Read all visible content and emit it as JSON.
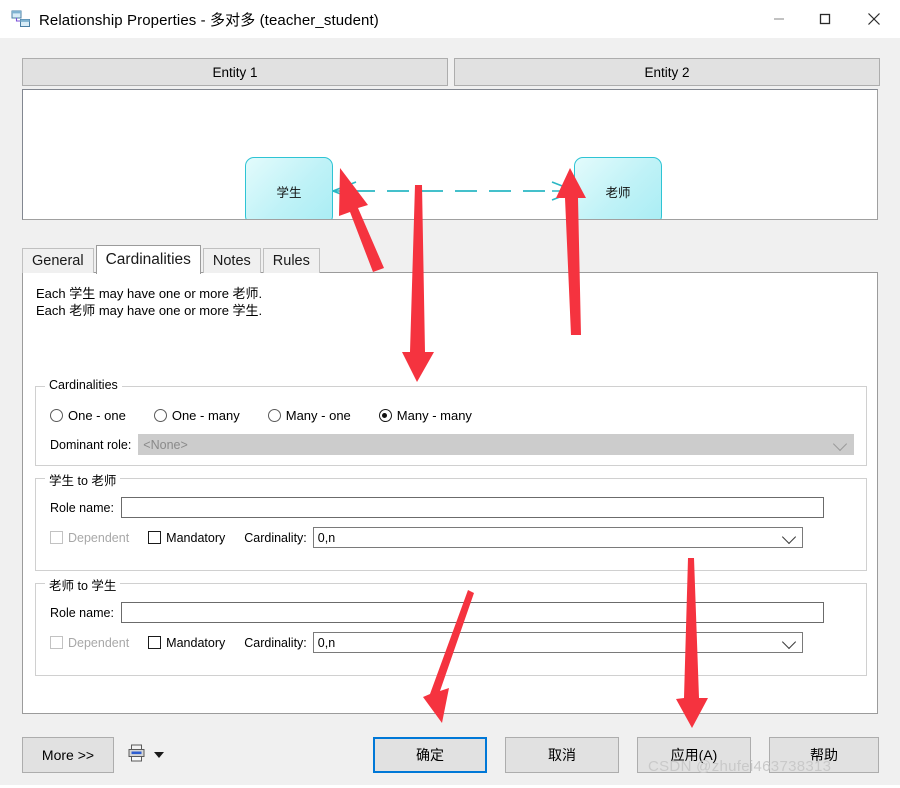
{
  "window": {
    "title": "Relationship Properties - 多对多 (teacher_student)",
    "icon": "relationship-icon",
    "minimize_label": "—",
    "maximize_label": "□",
    "close_label": "✕"
  },
  "entity_bar": {
    "entity1_label": "Entity 1",
    "entity2_label": "Entity 2"
  },
  "diagram": {
    "left_entity": "学生",
    "right_entity": "老师",
    "entity_fill": "#bff2f7",
    "entity_border": "#2ec4d4",
    "connector_color": "#2ab7c4",
    "connector_style": "dashed",
    "connector_end_markers": "crows-foot"
  },
  "tabs": [
    {
      "label": "General",
      "active": false
    },
    {
      "label": "Cardinalities",
      "active": true
    },
    {
      "label": "Notes",
      "active": false
    },
    {
      "label": "Rules",
      "active": false
    }
  ],
  "description": "Each 学生 may have one or more 老师.\nEach 老师 may have one or more 学生.",
  "cardinalities_group": {
    "title": "Cardinalities",
    "options": [
      {
        "label": "One - one",
        "selected": false
      },
      {
        "label": "One - many",
        "selected": false
      },
      {
        "label": "Many - one",
        "selected": false
      },
      {
        "label": "Many - many",
        "selected": true
      }
    ],
    "dominant_role_label": "Dominant role:",
    "dominant_role_value": "<None>",
    "dominant_role_enabled": false
  },
  "role_groups": [
    {
      "title": "学生 to 老师",
      "role_name_label": "Role name:",
      "role_name_value": "",
      "dependent_label": "Dependent",
      "dependent_checked": false,
      "dependent_enabled": false,
      "mandatory_label": "Mandatory",
      "mandatory_checked": false,
      "mandatory_enabled": true,
      "cardinality_label": "Cardinality:",
      "cardinality_value": "0,n"
    },
    {
      "title": "老师 to 学生",
      "role_name_label": "Role name:",
      "role_name_value": "",
      "dependent_label": "Dependent",
      "dependent_checked": false,
      "dependent_enabled": false,
      "mandatory_label": "Mandatory",
      "mandatory_checked": false,
      "mandatory_enabled": true,
      "cardinality_label": "Cardinality:",
      "cardinality_value": "0,n"
    }
  ],
  "footer": {
    "more_label": "More >>",
    "print_icon": "printer-icon",
    "print_caret_icon": "caret-down-icon",
    "ok_label": "确定",
    "cancel_label": "取消",
    "apply_label": "应用(A)",
    "help_label": "帮助",
    "default_button": "确定",
    "focus_color": "#0078d7"
  },
  "watermark": "CSDN @zhufei463738313",
  "annotations": {
    "arrow_color": "#f5333f",
    "arrows": [
      {
        "name": "arrow-to-student-crowsfoot"
      },
      {
        "name": "arrow-to-teacher-crowsfoot"
      },
      {
        "name": "arrow-to-many-many-radio"
      },
      {
        "name": "arrow-to-ok-button"
      },
      {
        "name": "arrow-to-apply-button"
      }
    ]
  }
}
